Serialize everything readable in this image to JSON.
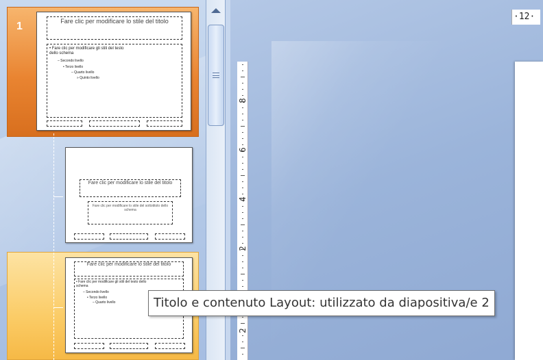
{
  "thumbnails": [
    {
      "number": "1",
      "title_placeholder": "Fare clic per modificare lo stile del titolo",
      "body_levels": [
        "• Fare clic per modificare gli stili del testo dello schema",
        "– Secondo livello",
        "• Terzo livello",
        "– Quarto livello",
        "» Quinto livello"
      ]
    },
    {
      "title_placeholder": "Fare clic per modificare lo stile del titolo",
      "subtitle_placeholder": "Fare clic per modificare lo stile del sottotitolo dello schema"
    },
    {
      "title_placeholder": "Fare clic per modificare lo stile del titolo",
      "body_levels": [
        "• Fare clic per modificare gli stili del testo dello schema",
        "– Secondo livello",
        "• Terzo livello",
        "– Quarto livello"
      ]
    }
  ],
  "ruler": {
    "top_value": "·12·",
    "vertical_numbers": [
      "8",
      "6",
      "4",
      "2",
      "2"
    ]
  },
  "tooltip": {
    "text": "Titolo e contenuto Layout: utilizzato da diapositiva/e 2"
  },
  "colors": {
    "selected_thumb_bg": "#e98431",
    "hover_thumb_bg": "#fbcc67",
    "workspace_bg": "#9bb4da"
  }
}
